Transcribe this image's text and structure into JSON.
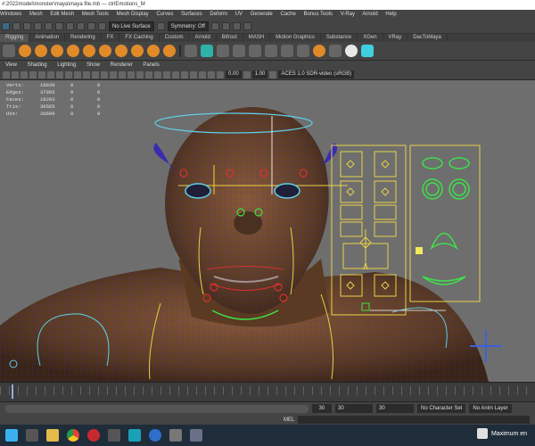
{
  "window": {
    "title": "#:2022model\\monster\\maya\\maya file.mb --- ctrlEmotions_M"
  },
  "menubar": [
    "Windows",
    "Mesh",
    "Edit Mesh",
    "Mesh Tools",
    "Mesh Display",
    "Curves",
    "Surfaces",
    "Deform",
    "UV",
    "Generate",
    "Cache",
    "Bonus Tools",
    "V-Ray",
    "Arnold",
    "Help"
  ],
  "status_line": {
    "live_surface": "No Live Surface",
    "symmetry": "Symmetry: Off"
  },
  "shelf_tabs": [
    "Rigging",
    "Animation",
    "Rendering",
    "FX",
    "FX Caching",
    "Custom",
    "Arnold",
    "Bifrost",
    "MASH",
    "Motion Graphics",
    "Substance",
    "XGen",
    "VRay",
    "DacToMaya"
  ],
  "shelf_active_tab_index": 0,
  "panel_menu": [
    "View",
    "Shading",
    "Lighting",
    "Show",
    "Renderer",
    "Panels"
  ],
  "panel_toolbar": {
    "value_a": "0.00",
    "value_b": "1.00",
    "color_space": "ACES 1.0 SDR-video (sRGB)"
  },
  "hud": {
    "rows": [
      {
        "label": "Verts:",
        "total": "18939",
        "selected": "0",
        "extra": "0"
      },
      {
        "label": "Edges:",
        "total": "37965",
        "selected": "0",
        "extra": "0"
      },
      {
        "label": "Faces:",
        "total": "18293",
        "selected": "0",
        "extra": "0"
      },
      {
        "label": "Tris:",
        "total": "36565",
        "selected": "0",
        "extra": "0"
      },
      {
        "label": "UVs:",
        "total": "20699",
        "selected": "0",
        "extra": "0"
      }
    ]
  },
  "range": {
    "start": "30",
    "end_a": "30",
    "end_b": "30",
    "character_set": "No Character Set",
    "anim_layer": "No Anim Layer"
  },
  "mel": {
    "label": "MEL"
  },
  "taskbar": {
    "notification": "Maximum en"
  },
  "colors": {
    "viewport_bg": "#6e6e6e",
    "mesh_skin": "#5a3a22",
    "wireframe": "#3a2cb0",
    "control_yellow": "#e8d24a",
    "control_green": "#3ee04a",
    "control_cyan": "#5fd0e8",
    "control_red": "#d83030",
    "cross_blue": "#3f5fd8"
  }
}
